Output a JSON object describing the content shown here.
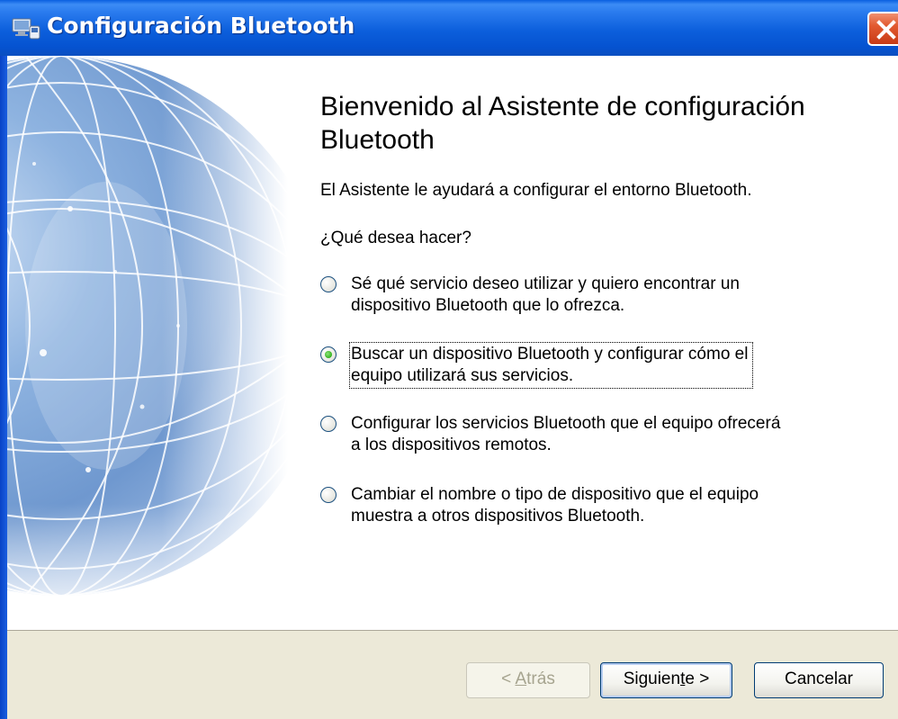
{
  "window": {
    "title": "Configuración Bluetooth"
  },
  "heading": "Bienvenido al Asistente de configuración Bluetooth",
  "intro": "El Asistente le ayudará a configurar el entorno Bluetooth.",
  "question": "¿Qué desea hacer?",
  "options": [
    {
      "label": "Sé qué servicio deseo utilizar y quiero encontrar un\ndispositivo Bluetooth que lo ofrezca.",
      "checked": false
    },
    {
      "label": "Buscar un dispositivo Bluetooth y configurar cómo el\nequipo utilizará sus servicios.",
      "checked": true
    },
    {
      "label": "Configurar los servicios Bluetooth que el equipo ofrecerá\na los dispositivos remotos.",
      "checked": false
    },
    {
      "label": "Cambiar el nombre o tipo de dispositivo que el equipo\nmuestra a otros dispositivos Bluetooth.",
      "checked": false
    }
  ],
  "buttons": {
    "back": {
      "prefix": "< ",
      "mnemonic": "A",
      "rest": "trás",
      "enabled": false
    },
    "next": {
      "prefix": "Siguien",
      "mnemonic": "t",
      "rest": "e >",
      "enabled": true
    },
    "cancel": {
      "label": "Cancelar",
      "enabled": true
    }
  },
  "icons": {
    "title": "bluetooth-device-icon",
    "close": "close-icon",
    "art": "globe-illustration"
  },
  "colors": {
    "titlebar": "#0552d0",
    "close_button": "#e25a30",
    "radio_checked": "#32b21c",
    "button_panel": "#ece9d8"
  }
}
